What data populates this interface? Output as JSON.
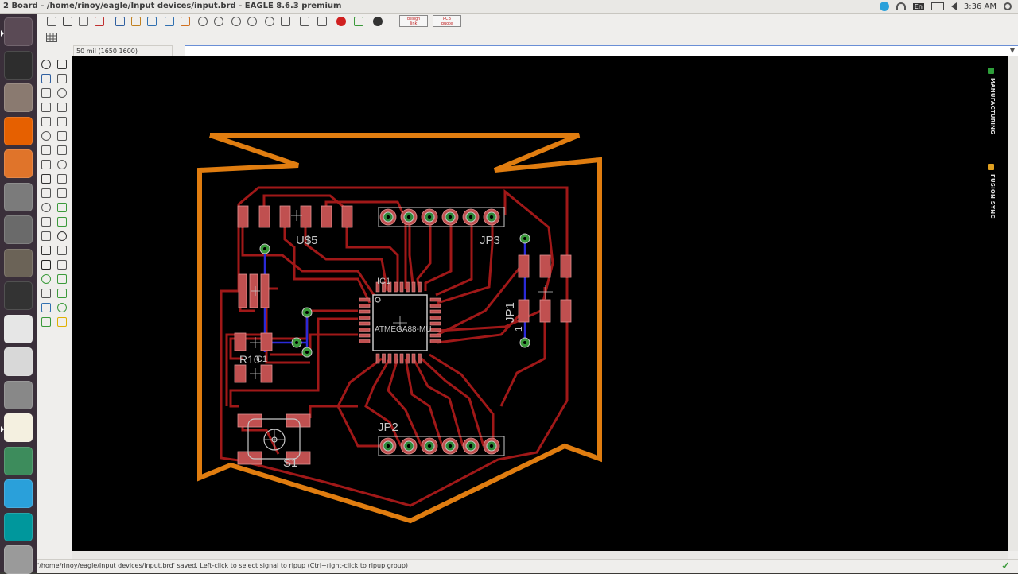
{
  "window": {
    "title": "2 Board - /home/rinoy/eagle/Input devices/input.brd - EAGLE 8.6.3 premium"
  },
  "system_tray": {
    "language": "En",
    "time": "3:36 AM"
  },
  "launcher": {
    "items": [
      {
        "name": "ubuntu-dash",
        "icon": "ubuntu-icon",
        "color": "#5a4a55"
      },
      {
        "name": "terminal",
        "icon": "terminal-icon",
        "color": "#2d2d2d"
      },
      {
        "name": "files",
        "icon": "files-icon",
        "color": "#8a7a70"
      },
      {
        "name": "firefox",
        "icon": "firefox-icon",
        "color": "#e66000"
      },
      {
        "name": "software-center",
        "icon": "software-center-icon",
        "color": "#e0742a"
      },
      {
        "name": "system-settings",
        "icon": "settings-icon",
        "color": "#7b7b7b"
      },
      {
        "name": "screenshot",
        "icon": "camera-icon",
        "color": "#6a6a6a"
      },
      {
        "name": "gimp",
        "icon": "gimp-icon",
        "color": "#6b6357"
      },
      {
        "name": "inkscape",
        "icon": "inkscape-icon",
        "color": "#333"
      },
      {
        "name": "libreoffice-draw",
        "icon": "draw-icon",
        "color": "#e6e6e6"
      },
      {
        "name": "text-editor",
        "icon": "text-editor-icon",
        "color": "#d8d8d8"
      },
      {
        "name": "help",
        "icon": "help-icon",
        "color": "#888"
      },
      {
        "name": "eagle",
        "icon": "eagle-icon",
        "color": "#f4f0e0"
      },
      {
        "name": "atom",
        "icon": "atom-icon",
        "color": "#3d8c5c"
      },
      {
        "name": "telegram",
        "icon": "telegram-icon",
        "color": "#2aa0da"
      },
      {
        "name": "arduino",
        "icon": "arduino-icon",
        "color": "#00979c"
      },
      {
        "name": "trash",
        "icon": "trash-icon",
        "color": "#9a9a9a"
      }
    ]
  },
  "toolbar": {
    "buttons": [
      "open-icon",
      "save-icon",
      "print-icon",
      "cam-processor-icon",
      "board-icon",
      "schematic-icon",
      "library-icon",
      "script-icon",
      "run-ulp-icon",
      "zoom-fit-icon",
      "zoom-in-icon",
      "zoom-out-icon",
      "zoom-select-icon",
      "zoom-area-icon",
      "redraw-icon",
      "undo-icon",
      "redo-icon",
      "stop-icon",
      "go-icon",
      "help-icon"
    ],
    "badges": [
      {
        "name": "design-link-button",
        "top": "design",
        "bottom": "link"
      },
      {
        "name": "pcb-quote-button",
        "top": "PCB",
        "bottom": "quote"
      }
    ],
    "grid_icon": "grid-icon"
  },
  "command": {
    "coordinate": "50 mil (1650 1600)",
    "input_value": ""
  },
  "side_panels": [
    {
      "label": "MANUFACTURING",
      "badge_color": "#2e9e3a"
    },
    {
      "label": "FUSION SYNC",
      "badge_color": "#e0a020"
    }
  ],
  "board": {
    "labels": {
      "usb": "U$5",
      "jp3": "JP3",
      "jp1": "JP1",
      "ic1": "IC1",
      "mcu": "ATMEGA88-MU",
      "c1": "C1",
      "r10": "R10",
      "jp2": "JP2",
      "s1": "S1",
      "pin1": "1"
    },
    "colors": {
      "outline": "#e07d10",
      "trace": "#a01818",
      "pad": "#c05050",
      "via_ring": "#3a9a3a",
      "airwire": "#2a2ad8",
      "silk": "#c8c8c8"
    }
  },
  "status": {
    "message": "'/home/rinoy/eagle/Input devices/input.brd' saved. Left-click to select signal to ripup (Ctrl+right-click to ripup group)"
  }
}
